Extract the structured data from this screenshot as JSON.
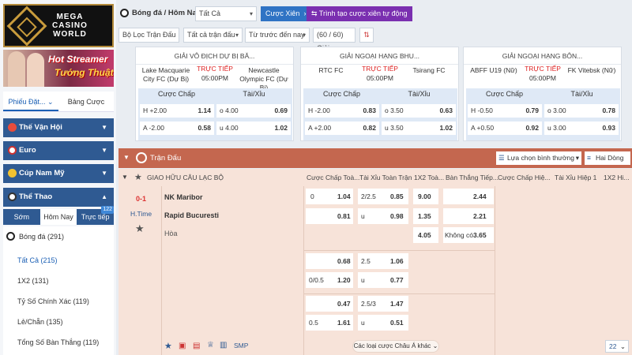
{
  "brand": {
    "logo_text": [
      "MEGA",
      "CASINO",
      "WORLD"
    ]
  },
  "banner": {
    "line1": "Hot Streamer",
    "line2": "Tướng Thuật"
  },
  "sidebar": {
    "tabs": [
      "Phiếu Đặt...",
      "Bảng Cược"
    ],
    "categories": [
      "Thế Vận Hội",
      "Euro",
      "Cúp Nam Mỹ",
      "Thể Thao"
    ],
    "subtabs": [
      "Sớm",
      "Hôm Nay",
      "Trực tiếp"
    ],
    "live_badge": "122",
    "sport": "Bóng đá",
    "sport_count": "(291)",
    "items": [
      "Tất Cả (215)",
      "1X2 (131)",
      "Tỷ Số Chính Xác (119)",
      "Lẻ/Chẵn (135)",
      "Tổng Số Bàn Thắng (119)"
    ]
  },
  "toolbar": {
    "breadcrumb": "Bóng đá / Hôm Nay",
    "filter_all": "Tất Cả",
    "parlay_button": "Cược Xiên",
    "parlay_builder_button": "Trình tạo cược xiên tự động",
    "league_filter": "Bộ Lọc Trận Đấu",
    "all_matches": "Tất cả trận đấu",
    "sort_time": "Từ trước đến nay",
    "league_count": "(60 / 60) Giải"
  },
  "featured": [
    {
      "league": "GIẢI VÔ ĐỊCH DỰ BỊ BĂ...",
      "home": "Lake Macquarie City FC (Dự Bị)",
      "away": "Newcastle Olympic FC (Dự Bị)",
      "live": "TRỰC TIẾP",
      "time": "05:00PM",
      "hdr_handicap": "Cược Chấp",
      "hdr_ou": "Tài/Xỉu",
      "rows": [
        {
          "hl": "H +2.00",
          "hv": "1.14",
          "ol": "o 4.00",
          "ov": "0.69"
        },
        {
          "hl": "A -2.00",
          "hv": "0.58",
          "ol": "u 4.00",
          "ov": "1.02"
        }
      ]
    },
    {
      "league": "GIẢI NGOẠI HẠNG BHU...",
      "home": "RTC FC",
      "away": "Tsirang FC",
      "live": "TRỰC TIẾP",
      "time": "05:00PM",
      "hdr_handicap": "Cược Chấp",
      "hdr_ou": "Tài/Xỉu",
      "rows": [
        {
          "hl": "H -2.00",
          "hv": "0.83",
          "ol": "o 3.50",
          "ov": "0.63"
        },
        {
          "hl": "A +2.00",
          "hv": "0.82",
          "ol": "u 3.50",
          "ov": "1.02"
        }
      ]
    },
    {
      "league": "GIẢI NGOẠI HẠNG BÔN...",
      "home": "ABFF U19 (Nữ)",
      "away": "FK Vitebsk (Nữ)",
      "live": "TRỰC TIẾP",
      "time": "05:00PM",
      "hdr_handicap": "Cược Chấp",
      "hdr_ou": "Tài/Xỉu",
      "rows": [
        {
          "hl": "H -0.50",
          "hv": "0.79",
          "ol": "o 3.00",
          "ov": "0.78"
        },
        {
          "hl": "A +0.50",
          "hv": "0.92",
          "ol": "u 3.00",
          "ov": "0.93"
        }
      ]
    }
  ],
  "matches_panel": {
    "title": "Trận Đấu",
    "view_select": "Lựa chọn bình thường",
    "line_select": "Hai Dòng",
    "league_row": "GIAO HỮU CÂU LẠC BỘ",
    "columns": [
      "Cược Chấp Toà...",
      "Tài Xỉu Toàn Trận",
      "1X2 Toà...",
      "Bàn Thắng Tiếp...",
      "Cược Chấp Hiệ...",
      "Tài Xỉu Hiệp 1",
      "1X2 Hi..."
    ]
  },
  "match": {
    "score": "0-1",
    "status": "H.Time",
    "home": "NK Maribor",
    "away": "Rapid Bucuresti",
    "draw": "Hòa",
    "main": {
      "hcp_line": "0",
      "hcp_home": "1.04",
      "hcp_away": "0.81",
      "ou_line": "2/2.5",
      "ou_over": "0.85",
      "ou_under_label": "u",
      "ou_under": "0.98",
      "x12_home": "9.00",
      "x12_away": "1.35",
      "x12_draw": "4.05",
      "next_home": "2.44",
      "next_away": "2.21",
      "next_none_label": "Không có",
      "next_none": "3.65"
    },
    "alt1": {
      "hcp_home": "0.68",
      "hcp_line": "0/0.5",
      "hcp_away": "1.20",
      "ou_line": "2.5",
      "ou_over": "1.06",
      "ou_under_label": "u",
      "ou_under": "0.77"
    },
    "alt2": {
      "hcp_home": "0.47",
      "hcp_line": "0.5",
      "hcp_away": "1.61",
      "ou_line": "2.5/3",
      "ou_over": "1.47",
      "ou_under_label": "u",
      "ou_under": "0.51"
    },
    "footer_more": "Các loại cược Châu Á khác",
    "footer_count": "22",
    "smp": "SMP"
  }
}
